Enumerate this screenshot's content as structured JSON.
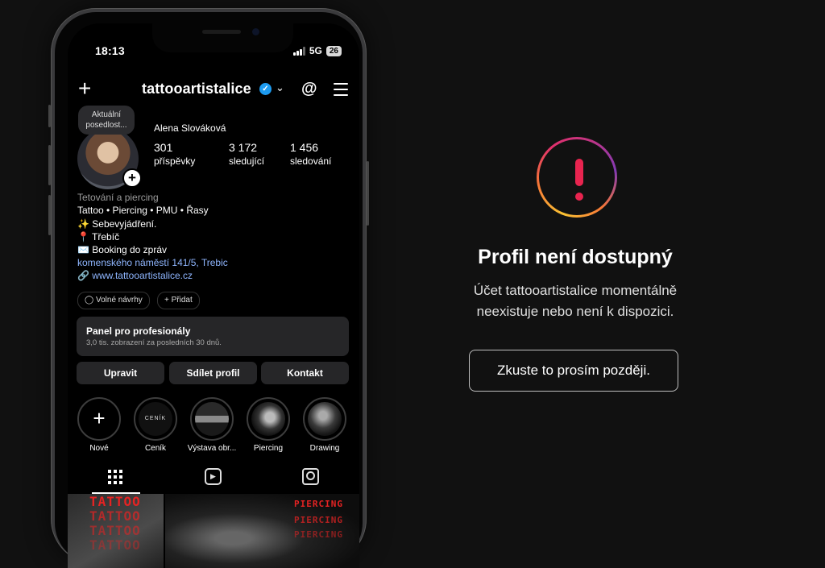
{
  "status": {
    "time": "18:13",
    "network": "5G",
    "battery": "26"
  },
  "header": {
    "username": "tattooartistalice",
    "verified_mark": "✓",
    "chevron": "⌄"
  },
  "profile": {
    "note": "Aktuální posedlost...",
    "name": "Alena Slováková",
    "stats": [
      {
        "value": "301",
        "label": "příspěvky"
      },
      {
        "value": "3 172",
        "label": "sledující"
      },
      {
        "value": "1 456",
        "label": "sledování"
      }
    ],
    "bio": {
      "category": "Tetování a piercing",
      "lines": [
        "Tattoo • Piercing • PMU • Řasy",
        "✨ Sebevyjádření.",
        "📍 Třebíč",
        "✉️ Booking do zpráv"
      ],
      "address": "komenského náměstí 141/5, Trebic",
      "website": "www.tattooartistalice.cz"
    }
  },
  "chips": [
    "Volné návrhy",
    "+ Přidat"
  ],
  "pro_panel": {
    "title": "Panel pro profesionály",
    "subtitle": "3,0 tis. zobrazení za posledních 30 dnů."
  },
  "actions": [
    "Upravit",
    "Sdílet profil",
    "Kontakt"
  ],
  "highlights": [
    "Nové",
    "Ceník",
    "Výstava obr...",
    "Piercing",
    "Drawing"
  ],
  "highlight_cover_text": "CENÍK",
  "grid_text": {
    "tattoo": "TATTOO",
    "piercing": "PIERCING"
  },
  "error": {
    "title": "Profil není dostupný",
    "message": "Účet tattooartistalice momentálně neexistuje nebo není k dispozici.",
    "button": "Zkuste to prosím později."
  },
  "colors": {
    "accent_red": "#e8244f",
    "link_blue": "#8fb6ff",
    "verified_blue": "#1d9bf0"
  }
}
